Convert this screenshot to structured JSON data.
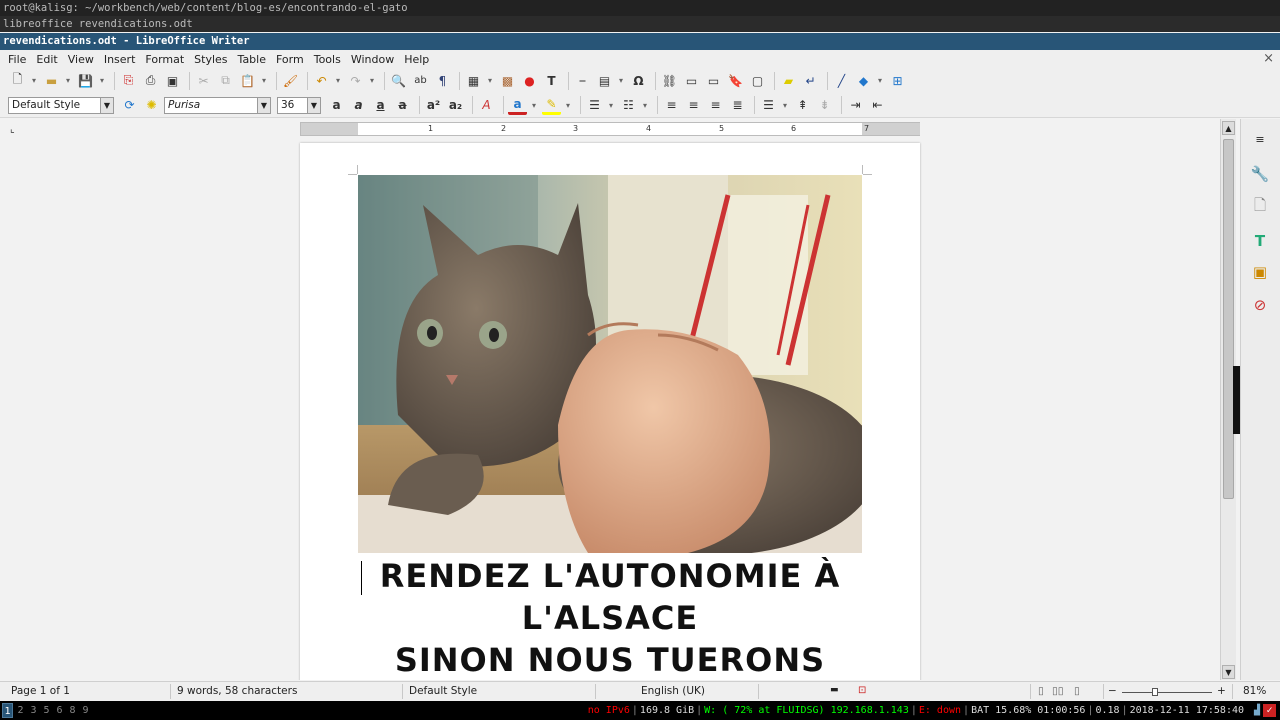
{
  "terminal": {
    "title_line": "root@kalisg: ~/workbench/web/content/blog-es/encontrando-el-gato",
    "command_line": "libreoffice revendications.odt"
  },
  "window": {
    "title": "revendications.odt - LibreOffice Writer"
  },
  "menubar": {
    "items": [
      "File",
      "Edit",
      "View",
      "Insert",
      "Format",
      "Styles",
      "Table",
      "Form",
      "Tools",
      "Window",
      "Help"
    ],
    "close_glyph": "×"
  },
  "formatting": {
    "paragraph_style": "Default Style",
    "font_name": "Purisa",
    "font_size": "36"
  },
  "ruler": {
    "numbers": [
      "1",
      "2",
      "3",
      "4",
      "5",
      "6",
      "7"
    ]
  },
  "document": {
    "headline_lines": [
      "RENDEZ L'AUTONOMIE À",
      "L'ALSACE",
      "SINON NOUS TUERONS"
    ],
    "image_subject": "tabby cat with hand"
  },
  "statusbar": {
    "page": "Page 1 of 1",
    "words": "9 words, 58 characters",
    "page_style": "Default Style",
    "language": "English (UK)",
    "zoom_percent": "81%"
  },
  "i3bar": {
    "workspaces": [
      "1",
      "2",
      "3",
      "5",
      "6",
      "8",
      "9"
    ],
    "active_workspace": "1",
    "ipv6": "no IPv6",
    "disk": "169.8 GiB",
    "wifi": "W: ( 72% at FLUIDSG) 192.168.1.143",
    "eth": "E: down",
    "battery": "BAT 15.68% 01:00:56",
    "load": "0.18",
    "datetime": "2018-12-11 17:58:40"
  },
  "colors": {
    "title_bar": "#285577",
    "accent_red": "#cc2222",
    "status_green": "#00ff00",
    "status_red": "#ff0000"
  }
}
